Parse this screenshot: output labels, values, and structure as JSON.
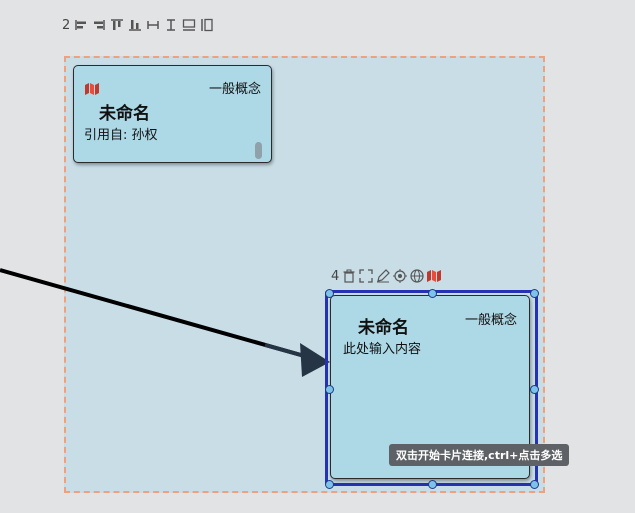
{
  "toolbar": {
    "selection_count": "2",
    "icons": [
      "align-left-icon",
      "align-right-icon",
      "align-top-icon",
      "align-bottom-icon",
      "distribute-horizontal-icon",
      "distribute-vertical-icon",
      "stack-vertical-icon",
      "stack-horizontal-icon"
    ]
  },
  "cards": [
    {
      "type": "一般概念",
      "title": "未命名",
      "body": "引用自: 孙权",
      "icon": "map-icon"
    },
    {
      "type": "一般概念",
      "title": "未命名",
      "body": "此处输入内容"
    }
  ],
  "card_tools": {
    "count": "4",
    "icons": [
      "delete-icon",
      "fullscreen-icon",
      "edit-icon",
      "target-icon",
      "globe-icon",
      "map-icon"
    ]
  },
  "tooltip": "双击开始卡片连接,ctrl+点击多选",
  "colors": {
    "canvas": "#e2e3e5",
    "selection_fill": "#c8dde6",
    "selection_border": "#f2a07c",
    "card_fill": "#add8e6",
    "active_frame": "#2432b3",
    "link": "#263545"
  }
}
